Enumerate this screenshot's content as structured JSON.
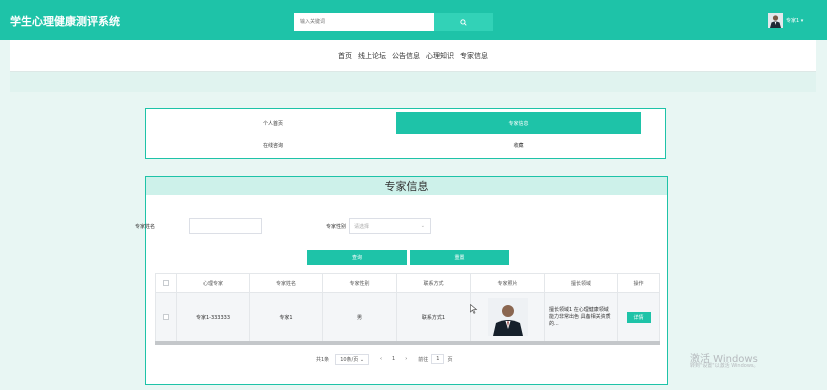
{
  "app": {
    "title": "学生心理健康测评系统"
  },
  "search": {
    "placeholder": "输入关键词"
  },
  "user": {
    "name": "专家1"
  },
  "nav": {
    "items": [
      "首页",
      "线上论坛",
      "公告信息",
      "心理知识",
      "专家信息"
    ]
  },
  "profile_tabs": [
    {
      "label": "个人首页",
      "active": false
    },
    {
      "label": "专家信息",
      "active": true
    },
    {
      "label": "在线咨询",
      "active": false
    },
    {
      "label": "收藏",
      "active": false
    }
  ],
  "section": {
    "title": "专家信息"
  },
  "filters": {
    "name_label": "专家姓名",
    "name_value": "",
    "gender_label": "专家性别",
    "gender_placeholder": "请选择"
  },
  "actions": {
    "query_label": "查询",
    "reset_label": "重置"
  },
  "table": {
    "columns": [
      "",
      "心理专家",
      "专家姓名",
      "专家性别",
      "联系方式",
      "专家照片",
      "擅长领域",
      "操作"
    ],
    "rows": [
      {
        "account": "专家1-333333",
        "name": "专家1",
        "gender": "男",
        "contact": "联系方式1",
        "specialty": "擅长领域1 在心理健康领域能力非常出色 具备相关资质的...",
        "action_label": "详情"
      }
    ]
  },
  "pagination": {
    "total": "共1条",
    "page_size": "10条/页",
    "prev": "‹",
    "current_page": "1",
    "next": "›",
    "goto_label": "前往",
    "goto_value": "1",
    "page_suffix": "页"
  },
  "watermark": {
    "title": "激活 Windows",
    "subtitle": "转到\"设置\"以激活 Windows。"
  },
  "colors": {
    "brand": "#1ec3a8",
    "page_bg": "#e8f6f3",
    "card_head": "#cdf1ea"
  }
}
